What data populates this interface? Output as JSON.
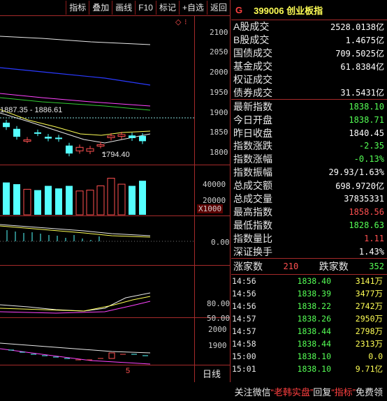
{
  "toolbar": {
    "buttons": [
      "指标",
      "叠加",
      "画线",
      "F10",
      "标记",
      "+自选",
      "返回"
    ]
  },
  "chart": {
    "price_axis": [
      "2100",
      "2050",
      "2000",
      "1950",
      "1900",
      "1850",
      "1800"
    ],
    "high_low_label": "1887.35 - 1886.61",
    "low_marker": "1794.40",
    "volume_axis": [
      "40000",
      "20000"
    ],
    "volume_unit": "X1000",
    "macd_axis": [
      "0.00"
    ],
    "kdj_axis": [
      "80.00",
      "50.00"
    ],
    "mini_axis": [
      "2000",
      "1900"
    ],
    "bottom_tab": "日线",
    "bottom_marker": "5"
  },
  "chart_data": {
    "type": "candlestick",
    "price_ylim": [
      1790,
      2110
    ],
    "candles": [
      {
        "open": 1882,
        "close": 1872,
        "color": "cyan"
      },
      {
        "open": 1868,
        "close": 1850,
        "color": "cyan"
      },
      {
        "open": 1842,
        "close": 1843,
        "color": "red"
      },
      {
        "open": 1860,
        "close": 1858,
        "color": "cyan"
      },
      {
        "open": 1850,
        "close": 1846,
        "color": "cyan"
      },
      {
        "open": 1848,
        "close": 1845,
        "color": "cyan"
      },
      {
        "open": 1830,
        "close": 1812,
        "color": "cyan"
      },
      {
        "open": 1818,
        "close": 1826,
        "color": "red"
      },
      {
        "open": 1817,
        "close": 1823,
        "color": "red"
      },
      {
        "open": 1830,
        "close": 1832,
        "color": "red"
      },
      {
        "open": 1848,
        "close": 1852,
        "color": "red"
      },
      {
        "open": 1851,
        "close": 1855,
        "color": "red"
      },
      {
        "open": 1853,
        "close": 1847,
        "color": "cyan"
      },
      {
        "open": 1852,
        "close": 1840,
        "color": "cyan"
      }
    ],
    "volumes": [
      38000,
      36000,
      30000,
      29000,
      34000,
      31000,
      34000,
      28000,
      29000,
      34000,
      43000,
      36000,
      34000,
      40000
    ],
    "volume_ylim": [
      0,
      50000
    ]
  },
  "panel": {
    "g_mark": "G",
    "title": "399006 创业板指",
    "section1": [
      {
        "label": "A股成交",
        "value": "2528.0138亿",
        "color": "#ffffff"
      },
      {
        "label": "B股成交",
        "value": "1.4675亿",
        "color": "#ffffff"
      },
      {
        "label": "国债成交",
        "value": "709.5025亿",
        "color": "#ffffff"
      },
      {
        "label": "基金成交",
        "value": "61.8384亿",
        "color": "#ffffff"
      },
      {
        "label": "权证成交",
        "value": "",
        "color": "#ffffff"
      },
      {
        "label": "债券成交",
        "value": "31.5431亿",
        "color": "#ffffff"
      }
    ],
    "section2": [
      {
        "label": "最新指数",
        "value": "1838.10",
        "color": "#55ff55"
      },
      {
        "label": "今日开盘",
        "value": "1838.71",
        "color": "#55ff55"
      },
      {
        "label": "昨日收盘",
        "value": "1840.45",
        "color": "#ffffff"
      },
      {
        "label": "指数涨跌",
        "value": "-2.35",
        "color": "#55ff55"
      },
      {
        "label": "指数涨幅",
        "value": "-0.13%",
        "color": "#55ff55"
      },
      {
        "label": "指数振幅",
        "value": "29.93/1.63%",
        "color": "#ffffff"
      },
      {
        "label": "总成交额",
        "value": "698.9720亿",
        "color": "#ffffff"
      },
      {
        "label": "总成交量",
        "value": "37835331",
        "color": "#ffffff"
      },
      {
        "label": "最高指数",
        "value": "1858.56",
        "color": "#ff5050"
      },
      {
        "label": "最低指数",
        "value": "1828.63",
        "color": "#55ff55"
      },
      {
        "label": "指数量比",
        "value": "1.11",
        "color": "#ff5050"
      },
      {
        "label": "深证换手",
        "value": "1.43%",
        "color": "#ffffff"
      }
    ],
    "breadth": {
      "up_label": "涨家数",
      "up_value": "210",
      "down_label": "跌家数",
      "down_value": "352"
    },
    "trades": [
      {
        "time": "14:56",
        "price": "1838.40",
        "vol": "3141万"
      },
      {
        "time": "14:56",
        "price": "1838.39",
        "vol": "3477万"
      },
      {
        "time": "14:56",
        "price": "1838.22",
        "vol": "2742万"
      },
      {
        "time": "14:57",
        "price": "1838.26",
        "vol": "2950万"
      },
      {
        "time": "14:57",
        "price": "1838.44",
        "vol": "2798万"
      },
      {
        "time": "14:58",
        "price": "1838.44",
        "vol": "2313万"
      },
      {
        "time": "15:00",
        "price": "1838.10",
        "vol": "0.0"
      },
      {
        "time": "15:01",
        "price": "1838.10",
        "vol": "9.71亿"
      }
    ]
  },
  "watermark": {
    "prefix": "关注微信",
    "q1": "“老韩实盘”",
    "mid": "回复",
    "q2": "“指标”",
    "suffix": "免费领"
  }
}
